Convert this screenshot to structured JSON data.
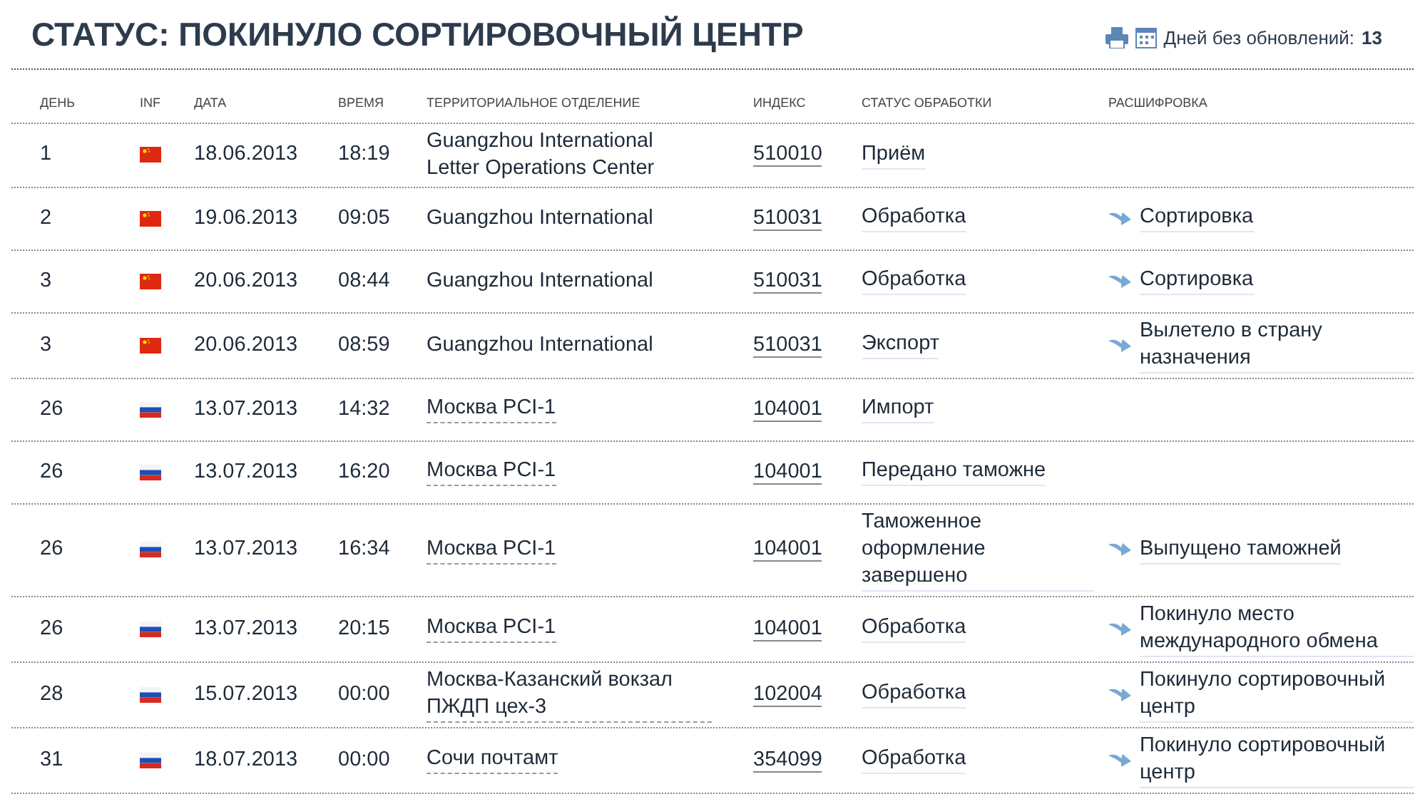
{
  "title": "СТАТУС: ПОКИНУЛО СОРТИРОВОЧНЫЙ ЦЕНТР",
  "days_label": "Дней без обновлений:",
  "days_value": "13",
  "columns": [
    "ДЕНЬ",
    "INF",
    "ДАТА",
    "ВРЕМЯ",
    "ТЕРРИТОРИАЛЬНОЕ ОТДЕЛЕНИЕ",
    "ИНДЕКС",
    "СТАТУС ОБРАБОТКИ",
    "РАСШИФРОВКА"
  ],
  "rows": [
    {
      "day": "1",
      "kind": "cn",
      "date": "18.06.2013",
      "time": "18:19",
      "office": "Guangzhou International Letter Operations Center",
      "office_link": false,
      "index": "510010",
      "status": "Приём"
    },
    {
      "day": "2",
      "kind": "cn",
      "date": "19.06.2013",
      "time": "09:05",
      "office": "Guangzhou International",
      "office_link": false,
      "index": "510031",
      "status": "Обработка",
      "detail": "Сортировка"
    },
    {
      "day": "3",
      "kind": "cn",
      "date": "20.06.2013",
      "time": "08:44",
      "office": "Guangzhou International",
      "office_link": false,
      "index": "510031",
      "status": "Обработка",
      "detail": "Сортировка"
    },
    {
      "day": "3",
      "kind": "cn",
      "date": "20.06.2013",
      "time": "08:59",
      "office": "Guangzhou International",
      "office_link": false,
      "index": "510031",
      "status": "Экспорт",
      "detail": "Вылетело в страну назначения"
    },
    {
      "day": "26",
      "kind": "ru",
      "date": "13.07.2013",
      "time": "14:32",
      "office": "Москва PCI-1",
      "office_link": true,
      "index": "104001",
      "status": "Импорт"
    },
    {
      "day": "26",
      "kind": "ru",
      "date": "13.07.2013",
      "time": "16:20",
      "office": "Москва PCI-1",
      "office_link": true,
      "index": "104001",
      "status": "Передано таможне"
    },
    {
      "day": "26",
      "kind": "ru",
      "date": "13.07.2013",
      "time": "16:34",
      "office": "Москва PCI-1",
      "office_link": true,
      "index": "104001",
      "status": "Таможенное оформление завершено",
      "detail": "Выпущено таможней"
    },
    {
      "day": "26",
      "kind": "ru",
      "date": "13.07.2013",
      "time": "20:15",
      "office": "Москва PCI-1",
      "office_link": true,
      "index": "104001",
      "status": "Обработка",
      "detail": "Покинуло место международного обмена"
    },
    {
      "day": "28",
      "kind": "ru",
      "date": "15.07.2013",
      "time": "00:00",
      "office": "Москва-Казанский вокзал ПЖДП цех-3",
      "office_link": true,
      "index": "102004",
      "status": "Обработка",
      "detail": "Покинуло сортировочный центр"
    },
    {
      "day": "31",
      "kind": "ru",
      "date": "18.07.2013",
      "time": "00:00",
      "office": "Сочи почтамт",
      "office_link": true,
      "index": "354099",
      "status": "Обработка",
      "detail": "Покинуло сортировочный центр"
    }
  ]
}
